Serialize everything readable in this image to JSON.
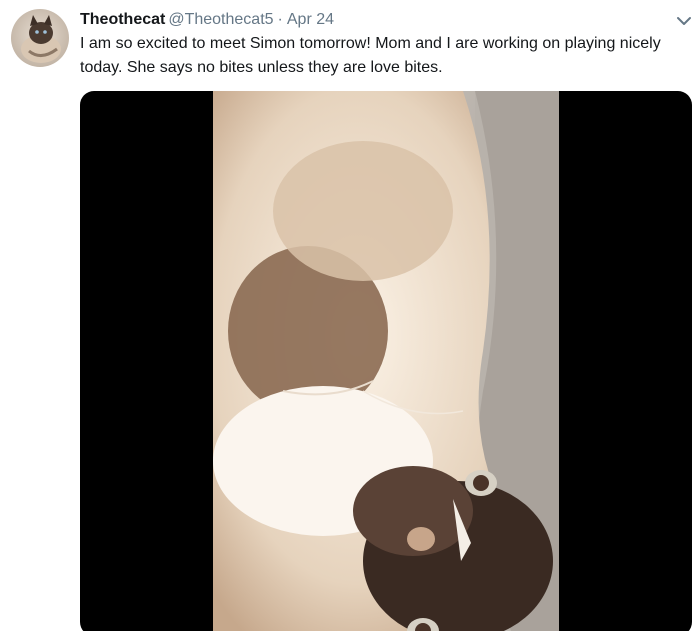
{
  "tweet": {
    "author": {
      "display_name": "Theothecat",
      "handle": "@Theothecat5",
      "avatar_icon": "cat-avatar"
    },
    "separator": "·",
    "date": "Apr 24",
    "text": "I am so excited to meet Simon tomorrow! Mom and I are working on playing nicely today. She says no bites unless they are love bites.",
    "menu_icon": "chevron-down-icon",
    "media": {
      "type": "video",
      "subject": "cat-photo"
    }
  },
  "colors": {
    "text_primary": "#14171a",
    "text_secondary": "#657786",
    "media_background": "#000000"
  }
}
